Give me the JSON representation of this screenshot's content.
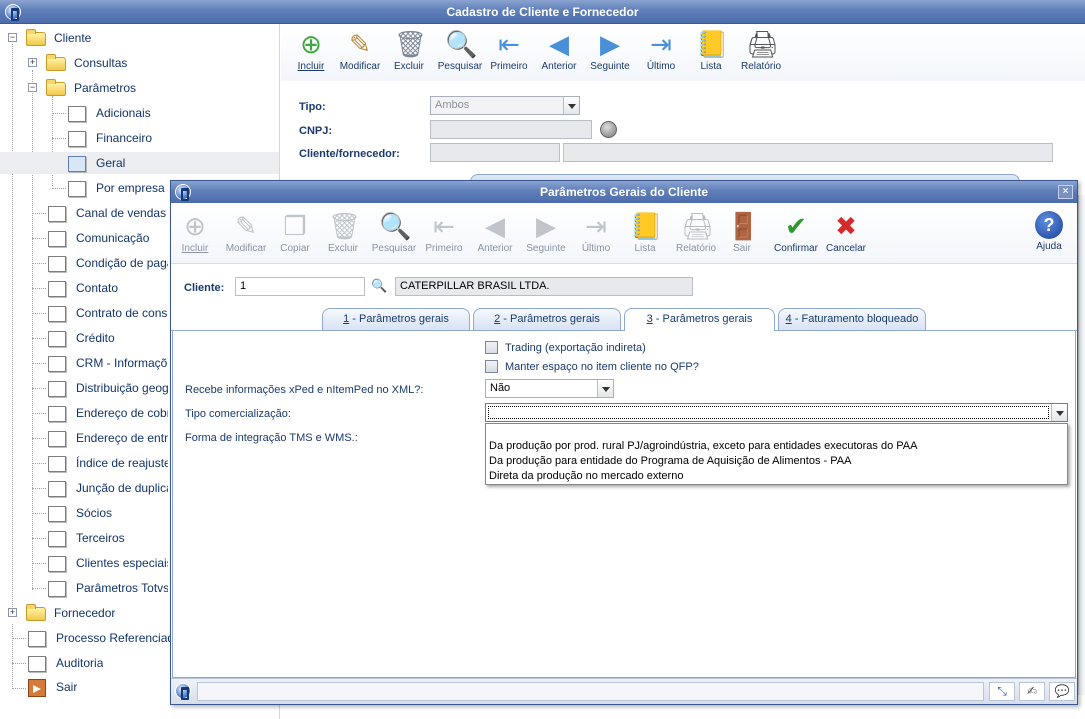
{
  "window": {
    "title": "Cadastro de Cliente e Fornecedor"
  },
  "tree": {
    "root_cliente": "Cliente",
    "consultas": "Consultas",
    "parametros": "Parâmetros",
    "adicionais": "Adicionais",
    "financeiro": "Financeiro",
    "geral": "Geral",
    "por_empresa": "Por empresa",
    "items": [
      "Canal de vendas",
      "Comunicação",
      "Condição de pagan",
      "Contato",
      "Contrato de consig",
      "Crédito",
      "CRM - Informações",
      "Distribuição geogra",
      "Endereço de cobra",
      "Endereço de entreg",
      "Índice de reajuste",
      "Junção de duplicata",
      "Sócios",
      "Terceiros",
      "Clientes especiais -",
      "Parâmetros Totvs C"
    ],
    "fornecedor": "Fornecedor",
    "processo": "Processo Referenciado",
    "auditoria": "Auditoria",
    "sair": "Sair"
  },
  "main_toolbar": {
    "incluir": "Incluir",
    "modificar": "Modificar",
    "excluir": "Excluir",
    "pesquisar": "Pesquisar",
    "primeiro": "Primeiro",
    "anterior": "Anterior",
    "seguinte": "Seguinte",
    "ultimo": "Último",
    "lista": "Lista",
    "relatorio": "Relatório"
  },
  "main_form": {
    "tipo_label": "Tipo:",
    "tipo_value": "Ambos",
    "cnpj_label": "CNPJ:",
    "cliente_label": "Cliente/fornecedor:"
  },
  "dialog": {
    "title": "Parâmetros Gerais do Cliente",
    "close": "×",
    "toolbar": {
      "incluir": "Incluir",
      "modificar": "Modificar",
      "copiar": "Copiar",
      "excluir": "Excluir",
      "pesquisar": "Pesquisar",
      "primeiro": "Primeiro",
      "anterior": "Anterior",
      "seguinte": "Seguinte",
      "ultimo": "Último",
      "lista": "Lista",
      "relatorio": "Relatório",
      "sair": "Sair",
      "confirmar": "Confirmar",
      "cancelar": "Cancelar",
      "ajuda": "Ajuda"
    },
    "cliente_label": "Cliente:",
    "cliente_code": "1",
    "cliente_name": "CATERPILLAR BRASIL LTDA.",
    "tabs": [
      {
        "num": "1",
        "label": " - Parâmetros gerais"
      },
      {
        "num": "2",
        "label": " - Parâmetros gerais"
      },
      {
        "num": "3",
        "label": " - Parâmetros gerais"
      },
      {
        "num": "4",
        "label": " - Faturamento bloqueado"
      }
    ],
    "trading_label": "Trading (exportação indireta)",
    "manter_label": "Manter espaço no item cliente no QFP?",
    "recebe_label": "Recebe informações xPed e nItemPed no XML?:",
    "recebe_value": "Não",
    "tipo_com_label": "Tipo comercialização:",
    "forma_label": "Forma de integração TMS e WMS.:",
    "dropdown_options": [
      "",
      "Da produção por prod. rural PJ/agroindústria, exceto para entidades executoras do PAA",
      "Da produção para entidade do Programa de Aquisição de Alimentos - PAA",
      "Direta da produção no mercado externo"
    ]
  }
}
